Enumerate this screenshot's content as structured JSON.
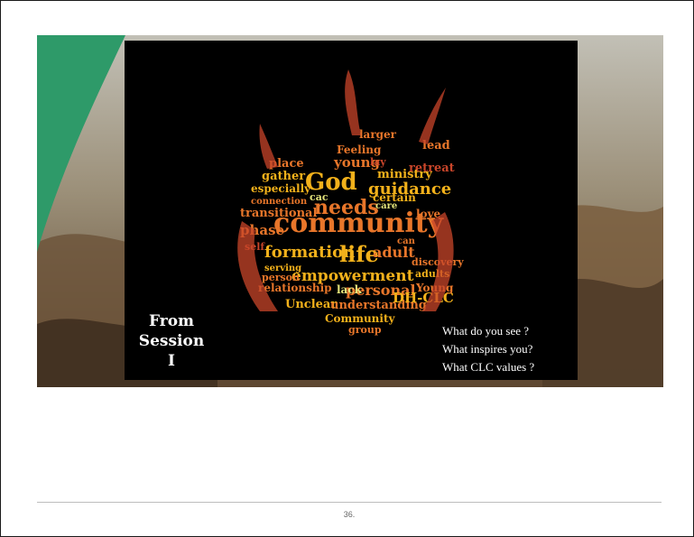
{
  "slide": {
    "label_lines": [
      "From",
      "Session",
      "I"
    ],
    "questions": [
      "What do you see ?",
      "What inspires you?",
      "What CLC values ?"
    ],
    "word_cloud": {
      "shape": "flame",
      "colors": {
        "large": "#f2b11b",
        "medium": "#e8762a",
        "small": "#c8452a",
        "accent": "#e3e37a"
      },
      "words": [
        "community",
        "God",
        "needs",
        "guidance",
        "formation",
        "life",
        "adult",
        "empowerment",
        "personal",
        "young",
        "Feeling",
        "lead",
        "retreat",
        "ministry",
        "place",
        "gather",
        "especially",
        "connection",
        "transitional",
        "phase",
        "self",
        "serving",
        "person",
        "relationship",
        "lack",
        "Unclear",
        "understanding",
        "DH-CLC",
        "Community",
        "group",
        "discovery",
        "adults",
        "Young",
        "larger",
        "care",
        "certain",
        "love",
        "can",
        "lay",
        "cac"
      ]
    }
  },
  "footer": {
    "page_number": "36."
  },
  "colors": {
    "green_arc": "#2e9a69",
    "panel": "#000000"
  }
}
